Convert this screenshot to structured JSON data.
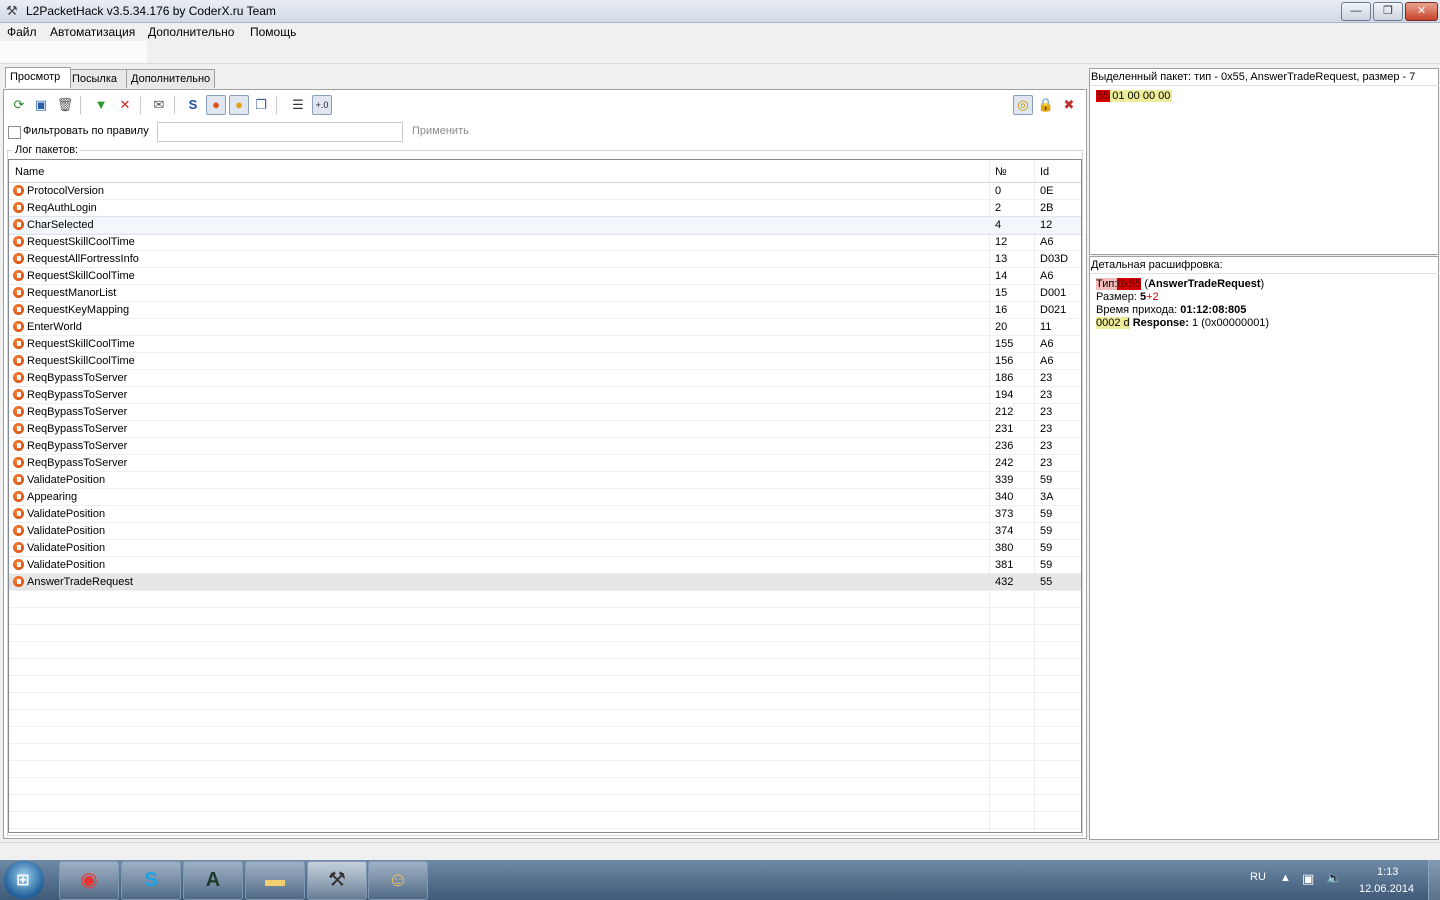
{
  "window": {
    "title": "L2PacketHack v3.5.34.176 by CoderX.ru Team",
    "buttons": {
      "minimize": "—",
      "maximize": "❐",
      "close": "✕"
    }
  },
  "menu": [
    "Файл",
    "Автоматизация",
    "Дополнительно",
    "Помощь"
  ],
  "tabs": [
    "Просмотр",
    "Посылка",
    "Дополнительно"
  ],
  "filter": {
    "label": "Фильтровать по правилу",
    "value": "",
    "apply_label": "Применить",
    "checked": false
  },
  "log": {
    "group_label": "Лог пакетов:",
    "columns": [
      "Name",
      "№",
      "Id"
    ],
    "rows": [
      {
        "name": "ProtocolVersion",
        "no": "0",
        "id": "0E"
      },
      {
        "name": "ReqAuthLogin",
        "no": "2",
        "id": "2B"
      },
      {
        "name": "CharSelected",
        "no": "4",
        "id": "12"
      },
      {
        "name": "RequestSkillCoolTime",
        "no": "12",
        "id": "A6"
      },
      {
        "name": "RequestAllFortressInfo",
        "no": "13",
        "id": "D03D"
      },
      {
        "name": "RequestSkillCoolTime",
        "no": "14",
        "id": "A6"
      },
      {
        "name": "RequestManorList",
        "no": "15",
        "id": "D001"
      },
      {
        "name": "RequestKeyMapping",
        "no": "16",
        "id": "D021"
      },
      {
        "name": "EnterWorld",
        "no": "20",
        "id": "11"
      },
      {
        "name": "RequestSkillCoolTime",
        "no": "155",
        "id": "A6"
      },
      {
        "name": "RequestSkillCoolTime",
        "no": "156",
        "id": "A6"
      },
      {
        "name": "ReqBypassToServer",
        "no": "186",
        "id": "23"
      },
      {
        "name": "ReqBypassToServer",
        "no": "194",
        "id": "23"
      },
      {
        "name": "ReqBypassToServer",
        "no": "212",
        "id": "23"
      },
      {
        "name": "ReqBypassToServer",
        "no": "231",
        "id": "23"
      },
      {
        "name": "ReqBypassToServer",
        "no": "236",
        "id": "23"
      },
      {
        "name": "ReqBypassToServer",
        "no": "242",
        "id": "23"
      },
      {
        "name": "ValidatePosition",
        "no": "339",
        "id": "59"
      },
      {
        "name": "Appearing",
        "no": "340",
        "id": "3A"
      },
      {
        "name": "ValidatePosition",
        "no": "373",
        "id": "59"
      },
      {
        "name": "ValidatePosition",
        "no": "374",
        "id": "59"
      },
      {
        "name": "ValidatePosition",
        "no": "380",
        "id": "59"
      },
      {
        "name": "ValidatePosition",
        "no": "381",
        "id": "59"
      },
      {
        "name": "AnswerTradeRequest",
        "no": "432",
        "id": "55"
      }
    ]
  },
  "selected_packet": {
    "header": "Выделенный пакет: тип - 0x55, AnswerTradeRequest, размер - 7",
    "hex_first": "55",
    "hex_rest": "01 00 00 00"
  },
  "decode": {
    "header": "Детальная расшифровка:",
    "type_label": "Тип:",
    "type_value": "0x55",
    "type_name": "AnswerTradeRequest",
    "size_label": "Размер:",
    "size_value": "5",
    "size_extra": "+2",
    "time_label": "Время прихода:",
    "time_value": "01:12:08:805",
    "field_offset": "0002 d",
    "field_name": "Response:",
    "field_value": "1 (0x00000001)"
  },
  "taskbar": {
    "apps": [
      "chrome",
      "skype",
      "archeage",
      "explorer",
      "packethack",
      "game"
    ],
    "lang": "RU",
    "time": "1:13",
    "date": "12.06.2014"
  },
  "colors": {
    "accent_red": "#d40000",
    "hex_yellow": "#ecec9a",
    "packet_icon": "#e05010"
  }
}
